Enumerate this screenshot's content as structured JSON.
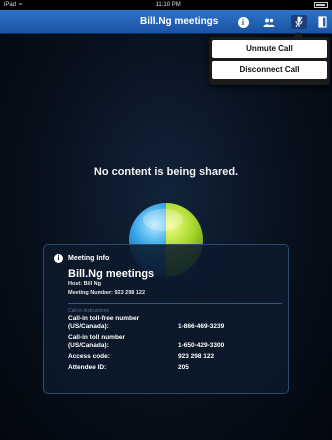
{
  "status_bar": {
    "carrier": "iPad",
    "time": "11:10 PM"
  },
  "nav": {
    "title": "Bill.Ng meetings",
    "info_icon_glyph": "i"
  },
  "popover": {
    "items": [
      {
        "label": "Unmute Call"
      },
      {
        "label": "Disconnect Call"
      }
    ]
  },
  "main": {
    "message": "No content is being shared."
  },
  "meeting_info": {
    "header": "Meeting Info",
    "title": "Bill.Ng meetings",
    "host": "Host: Bill Ng",
    "meeting_number": "Meeting Number: 923 298 122",
    "section_label": "Call-in instructions",
    "rows": [
      {
        "key_line1": "Call-in toll-free number",
        "key_line2": "(US/Canada):",
        "value": "1-866-469-3239"
      },
      {
        "key_line1": "Call-in toll number",
        "key_line2": "(US/Canada):",
        "value": "1-650-429-3300"
      },
      {
        "key": "Access code:",
        "value": "923 298 122"
      },
      {
        "key": "Attendee ID:",
        "value": "205"
      }
    ]
  },
  "colors": {
    "nav_blue": "#1f5fb3",
    "panel_bg": "#0c1a2c",
    "logo_blue": "#38a8e8",
    "logo_green": "#a8d62a"
  }
}
